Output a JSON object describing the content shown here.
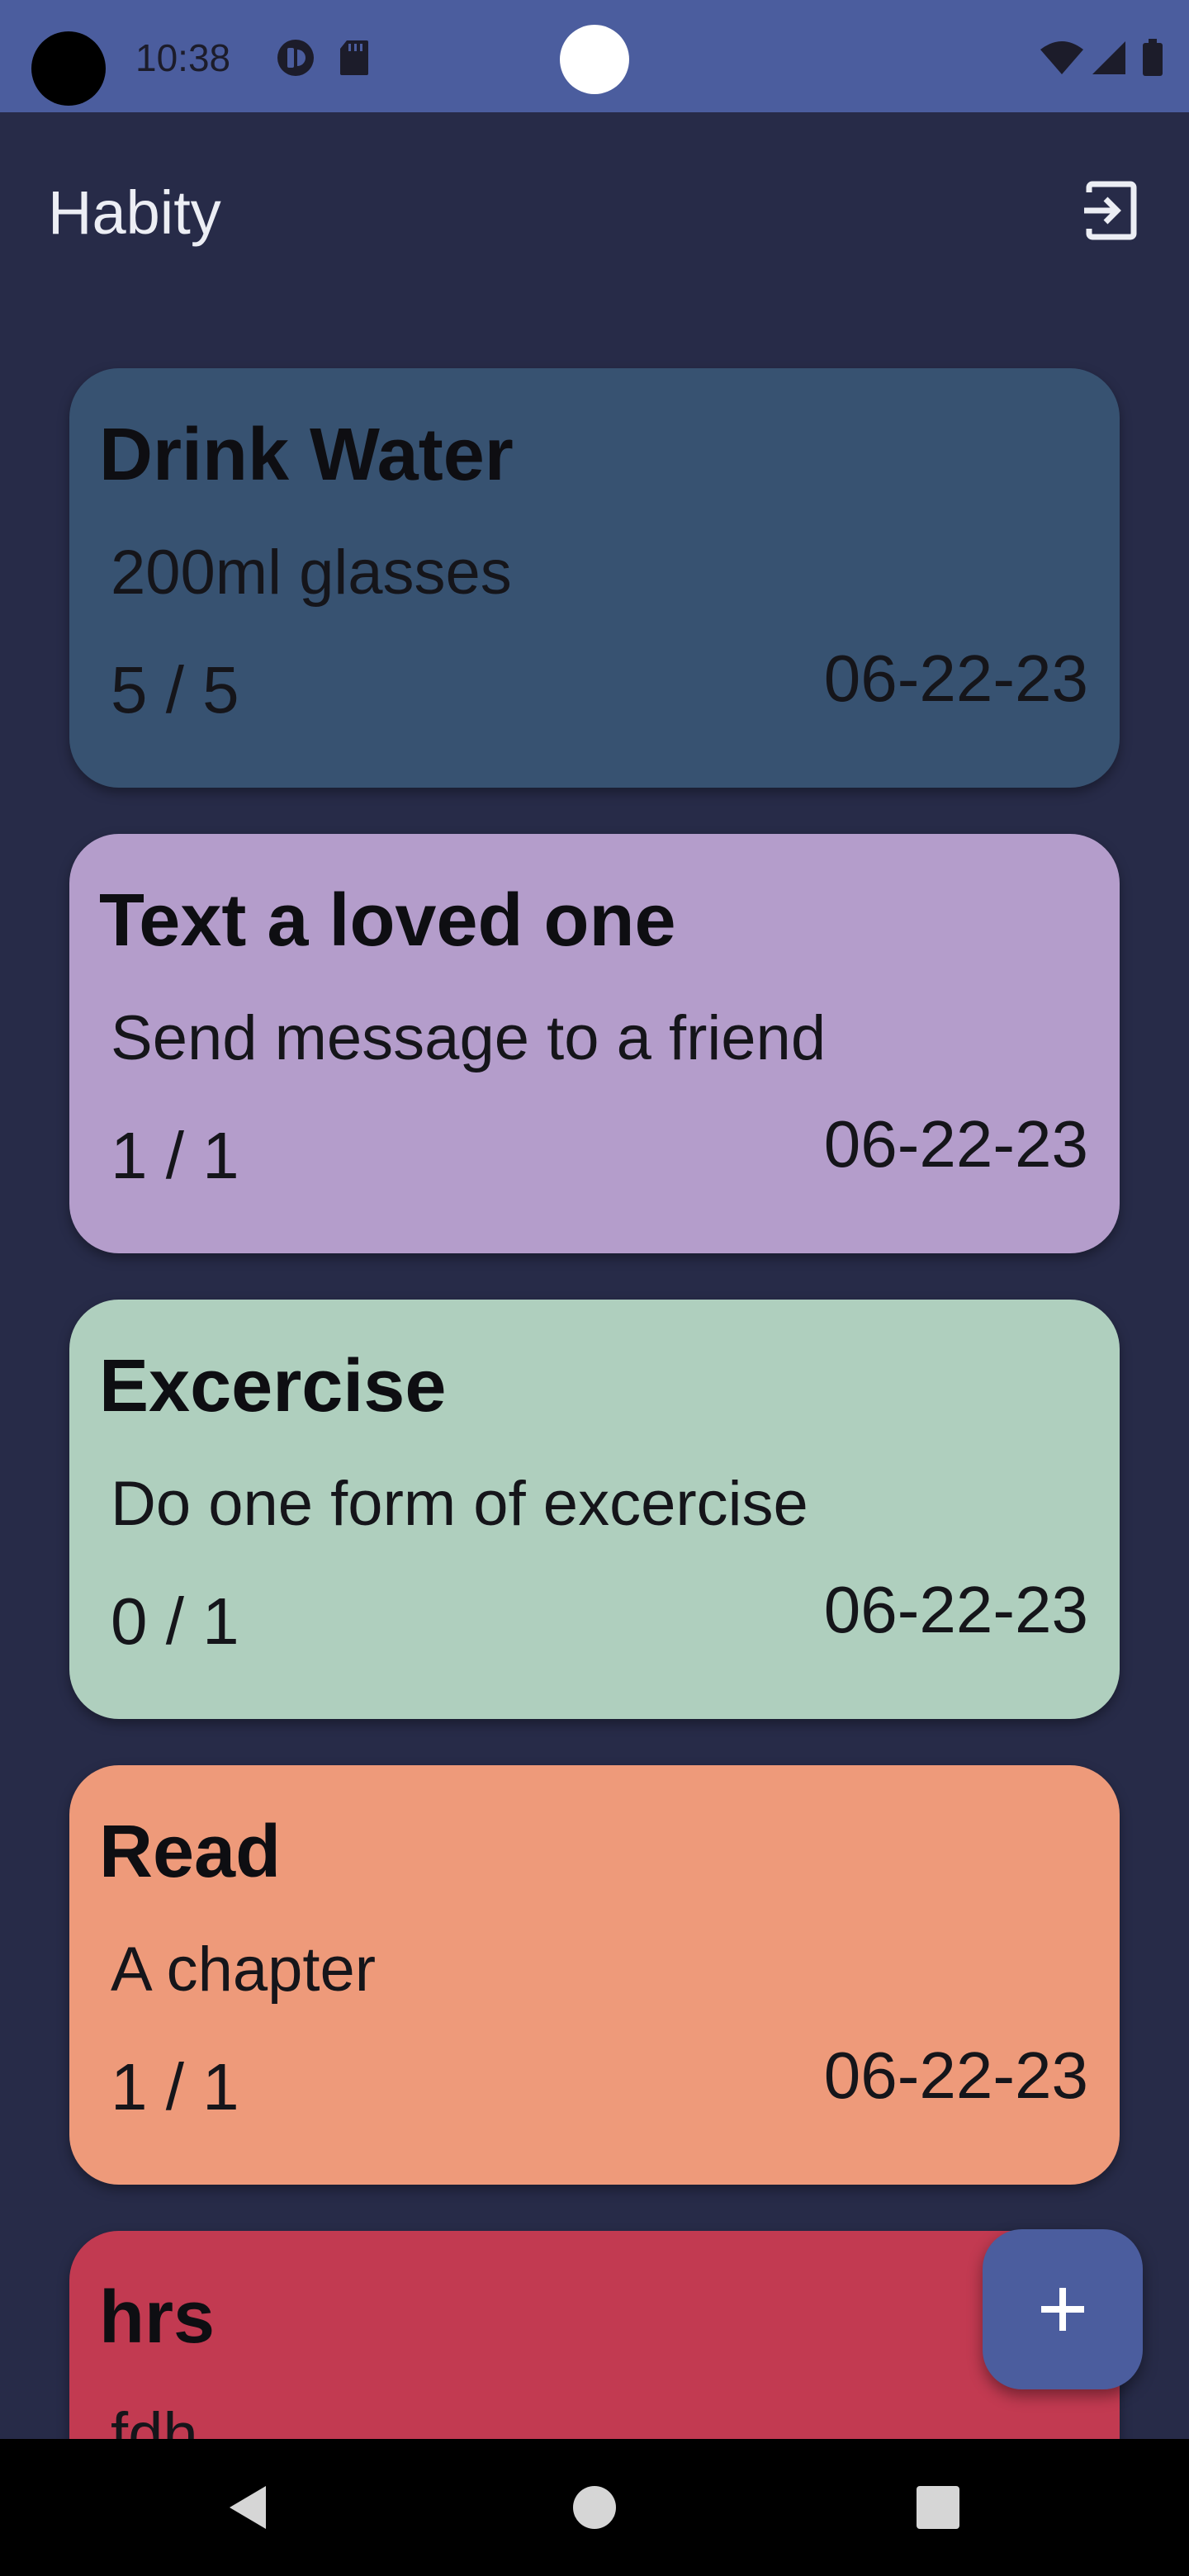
{
  "status_bar": {
    "time": "10:38",
    "icons": [
      "camera-cutout",
      "sync-icon",
      "sd-card-icon",
      "wifi-icon",
      "signal-icon",
      "battery-icon"
    ]
  },
  "app_bar": {
    "title": "Habity",
    "action_icon": "logout-icon"
  },
  "habits": [
    {
      "title": "Drink Water",
      "description": "200ml glasses",
      "progress": "5 / 5",
      "date": "06-22-23",
      "color": "#375271"
    },
    {
      "title": "Text a loved one",
      "description": "Send message to a friend",
      "progress": "1 / 1",
      "date": "06-22-23",
      "color": "#b49dcb"
    },
    {
      "title": "Excercise",
      "description": "Do one form of excercise",
      "progress": "0 / 1",
      "date": "06-22-23",
      "color": "#afcfbe"
    },
    {
      "title": "Read",
      "description": "A chapter",
      "progress": "1 / 1",
      "date": "06-22-23",
      "color": "#ee9a7a"
    },
    {
      "title": "hrs",
      "description": "fdh",
      "progress": "",
      "date": "",
      "color": "#c23a51"
    }
  ],
  "fab": {
    "icon": "plus-icon",
    "color": "#4b5d9e"
  },
  "nav_bar": {
    "buttons": [
      "back-icon",
      "home-icon",
      "recents-icon"
    ]
  },
  "colors": {
    "background": "#272b48",
    "status_bar": "#4b5d9e",
    "title_text": "#eceef4"
  }
}
